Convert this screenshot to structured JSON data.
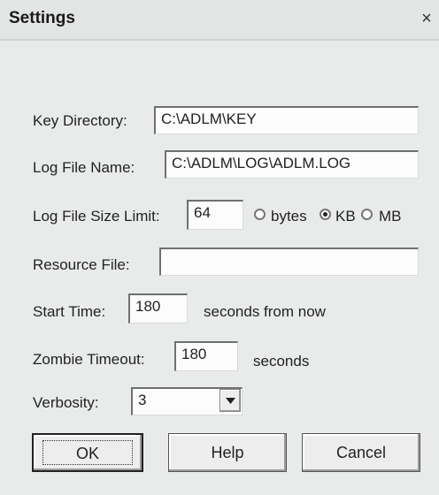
{
  "window": {
    "title": "Settings",
    "close_glyph": "×"
  },
  "form": {
    "key_directory": {
      "label": "Key Directory:",
      "value": "C:\\ADLM\\KEY"
    },
    "log_file_name": {
      "label": "Log File Name:",
      "value": "C:\\ADLM\\LOG\\ADLM.LOG"
    },
    "log_file_size_limit": {
      "label": "Log File Size Limit:",
      "value": "64",
      "units": [
        {
          "label": "bytes",
          "selected": false
        },
        {
          "label": "KB",
          "selected": true
        },
        {
          "label": "MB",
          "selected": false
        }
      ]
    },
    "resource_file": {
      "label": "Resource File:",
      "value": ""
    },
    "start_time": {
      "label": "Start Time:",
      "value": "180",
      "suffix": "seconds from now"
    },
    "zombie_timeout": {
      "label": "Zombie Timeout:",
      "value": "180",
      "suffix": "seconds"
    },
    "verbosity": {
      "label": "Verbosity:",
      "value": "3"
    }
  },
  "buttons": {
    "ok": "OK",
    "help": "Help",
    "cancel": "Cancel"
  }
}
